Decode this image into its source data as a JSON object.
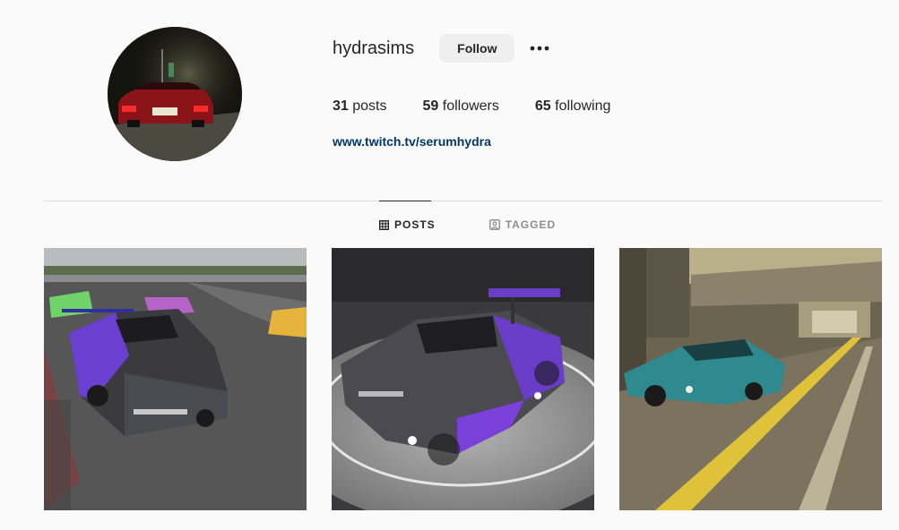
{
  "profile": {
    "username": "hydrasims",
    "follow_label": "Follow",
    "more_label": "•••",
    "stats": [
      {
        "count": "31",
        "label": "posts"
      },
      {
        "count": "59",
        "label": "followers"
      },
      {
        "count": "65",
        "label": "following"
      }
    ],
    "website": "www.twitch.tv/serumhydra"
  },
  "tabs": [
    {
      "label": "POSTS",
      "icon": "grid-icon",
      "active": true
    },
    {
      "label": "TAGGED",
      "icon": "tagged-icon",
      "active": false
    }
  ],
  "posts": [
    {
      "subject": "racing-cars-on-track"
    },
    {
      "subject": "race-car-showroom"
    },
    {
      "subject": "teal-muscle-car-tunnel"
    }
  ],
  "colors": {
    "background": "#fafafa",
    "link": "#00376b",
    "button_bg": "#efefef",
    "divider": "#dbdbdb"
  }
}
